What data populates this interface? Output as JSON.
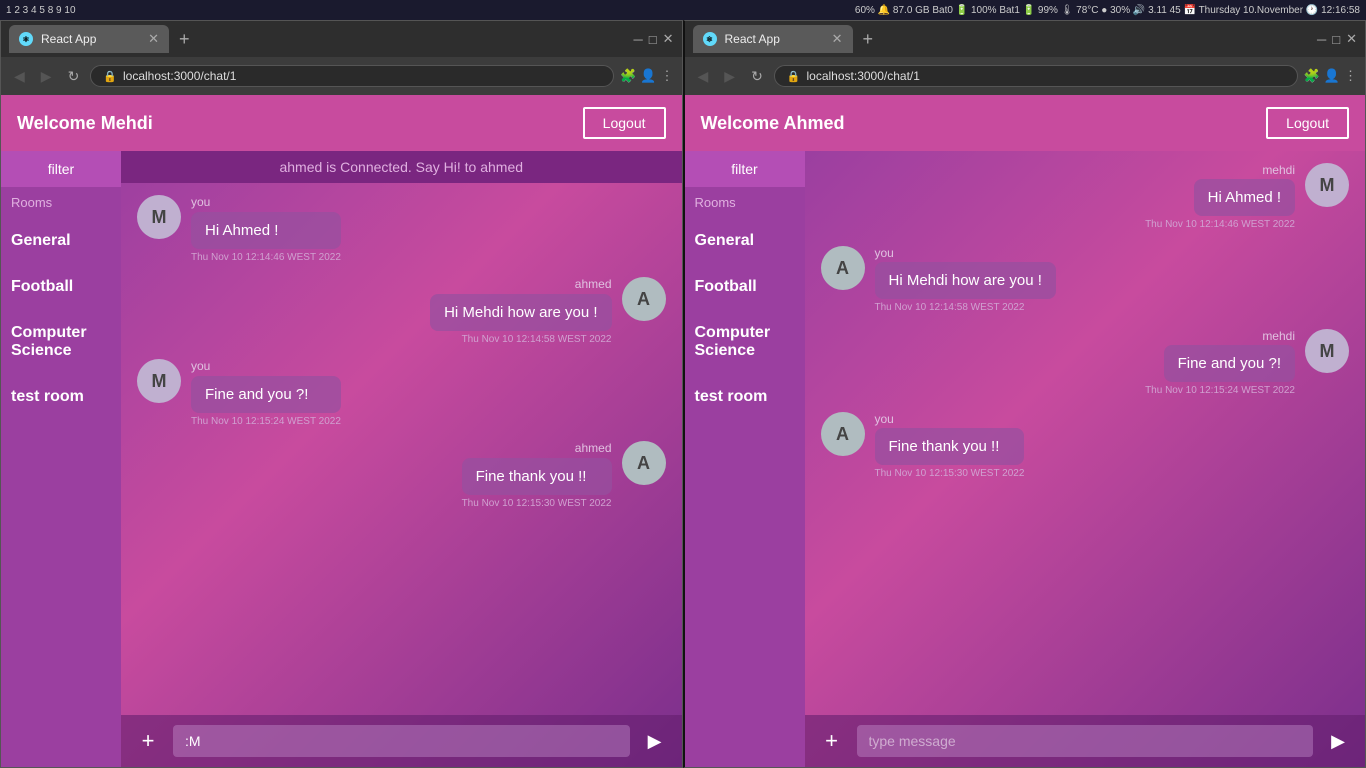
{
  "systemBar": {
    "left": "1 2 3 4 5 8 9 10",
    "right": "60% 🔔 87.0 GB Bat0 🔋 100% Bat1 🔋 99% 🌡 78°C ● 30% 🔊 3.11 45 📅 Thursday 10.November 🕐 12:16:58"
  },
  "leftBrowser": {
    "tab": "React App",
    "url": "localhost:3000/chat/1",
    "header": {
      "welcome": "Welcome ",
      "username": "Mehdi",
      "logout": "Logout"
    },
    "sidebar": {
      "filter": "filter",
      "rooms_label": "Rooms",
      "rooms": [
        "General",
        "Football",
        "Computer Science",
        "test room"
      ]
    },
    "banner": "ahmed is Connected. Say Hi! to ahmed",
    "messages": [
      {
        "sender": "you",
        "avatar": "M",
        "avatar_type": "m",
        "text": "Hi Ahmed !",
        "time": "Thu Nov 10 12:14:46 WEST 2022",
        "side": "own"
      },
      {
        "sender": "ahmed",
        "avatar": "A",
        "avatar_type": "a",
        "text": "Hi Mehdi how are you !",
        "time": "Thu Nov 10 12:14:58 WEST 2022",
        "side": "other"
      },
      {
        "sender": "you",
        "avatar": "M",
        "avatar_type": "m",
        "text": "Fine and you ?!",
        "time": "Thu Nov 10 12:15:24 WEST 2022",
        "side": "own"
      },
      {
        "sender": "ahmed",
        "avatar": "A",
        "avatar_type": "a",
        "text": "Fine thank you !!",
        "time": "Thu Nov 10 12:15:30 WEST 2022",
        "side": "other"
      }
    ],
    "input": {
      "value": ":M",
      "placeholder": "type message",
      "add": "+",
      "send": "▶"
    }
  },
  "rightBrowser": {
    "tab": "React App",
    "url": "localhost:3000/chat/1",
    "header": {
      "welcome": "Welcome ",
      "username": "Ahmed",
      "logout": "Logout"
    },
    "sidebar": {
      "filter": "filter",
      "rooms_label": "Rooms",
      "rooms": [
        "General",
        "Football",
        "Computer Science",
        "test room"
      ]
    },
    "messages": [
      {
        "sender": "mehdi",
        "avatar": "M",
        "avatar_type": "m",
        "text": "Hi Ahmed !",
        "time": "Thu Nov 10 12:14:46 WEST 2022",
        "side": "own"
      },
      {
        "sender": "you",
        "avatar": "A",
        "avatar_type": "a",
        "text": "Hi Mehdi how are you !",
        "time": "Thu Nov 10 12:14:58 WEST 2022",
        "side": "other"
      },
      {
        "sender": "mehdi",
        "avatar": "M",
        "avatar_type": "m",
        "text": "Fine and you ?!",
        "time": "Thu Nov 10 12:15:24 WEST 2022",
        "side": "own"
      },
      {
        "sender": "you",
        "avatar": "A",
        "avatar_type": "a",
        "text": "Fine thank you !!",
        "time": "Thu Nov 10 12:15:30 WEST 2022",
        "side": "other"
      }
    ],
    "input": {
      "value": "",
      "placeholder": "type message",
      "add": "+",
      "send": "▶"
    }
  }
}
